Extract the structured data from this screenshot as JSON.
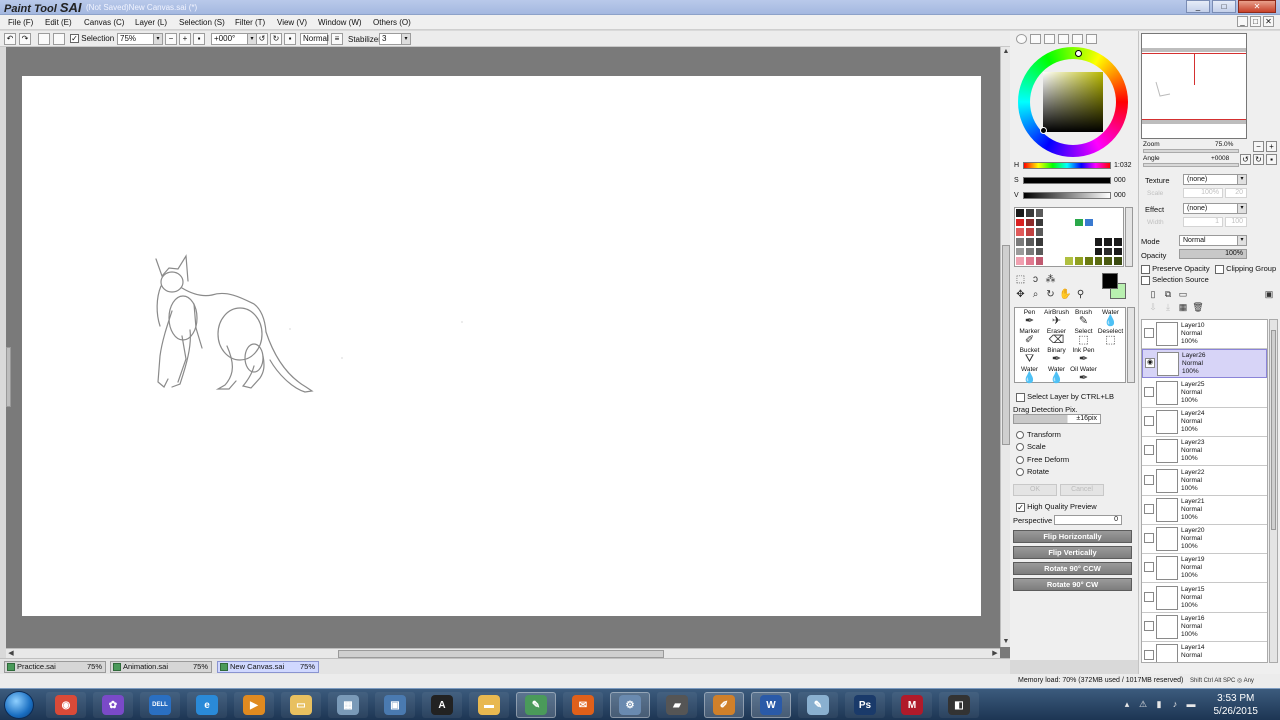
{
  "window": {
    "app_logo_small": "Paint Tool",
    "app_logo_big": "SAI",
    "title": "(Not Saved)New Canvas.sai (*)",
    "controls": {
      "minimize": "_",
      "maximize": "□",
      "close": "✕"
    }
  },
  "menu": {
    "items": [
      "File (F)",
      "Edit (E)",
      "Canvas (C)",
      "Layer (L)",
      "Selection (S)",
      "Filter (T)",
      "View (V)",
      "Window (W)",
      "Others (O)"
    ],
    "mdi": [
      "_",
      "□",
      "✕"
    ]
  },
  "toolbar": {
    "selection_label": "Selection",
    "selection_checked": "✓",
    "zoom": "75%",
    "angle": "+000°",
    "blend": "Normal",
    "stabilizer_label": "Stabilizer",
    "stabilizer_value": "3",
    "arrow": "▾"
  },
  "file_tabs": [
    {
      "name": "Practice.sai",
      "zoom": "75%"
    },
    {
      "name": "Animation.sai",
      "zoom": "75%"
    },
    {
      "name": "New Canvas.sai",
      "zoom": "75%"
    }
  ],
  "status": {
    "memory": "Memory load: 70% (372MB used / 1017MB reserved)",
    "keys": "Shift Ctrl Alt SPC ◎ Any"
  },
  "color": {
    "h_label": "H",
    "h_value": "1:032",
    "s_label": "S",
    "s_value": "000",
    "v_label": "V",
    "v_value": "000",
    "foreground": "#000000",
    "background": "#b9f0b0"
  },
  "swatches": [
    "#1a1a1a",
    "#3a3a3a",
    "#5a5a5a",
    "#ffffff",
    "#ffffff",
    "#ffffff",
    "#ffffff",
    "#ffffff",
    "#ffffff",
    "#ffffff",
    "#ffffff",
    "#d92020",
    "#8a2a2a",
    "#3a3a3a",
    "#ffffff",
    "#ffffff",
    "#ffffff",
    "#2aa84a",
    "#3a7ad0",
    "#ffffff",
    "#ffffff",
    "#ffffff",
    "#e05a5a",
    "#c04040",
    "#5a5a5a",
    "#ffffff",
    "#ffffff",
    "#ffffff",
    "#ffffff",
    "#ffffff",
    "#ffffff",
    "#ffffff",
    "#ffffff",
    "#7a7a7a",
    "#5a5a5a",
    "#3a3a3a",
    "#ffffff",
    "#ffffff",
    "#ffffff",
    "#ffffff",
    "#ffffff",
    "#1a1a1a",
    "#1a1a1a",
    "#1a1a1a",
    "#9a9a9a",
    "#7a7a7a",
    "#5a5a5a",
    "#ffffff",
    "#ffffff",
    "#ffffff",
    "#ffffff",
    "#ffffff",
    "#1a1a1a",
    "#2a2a2a",
    "#1a1a1a",
    "#f0a0b0",
    "#e07a90",
    "#c05a70",
    "#ffffff",
    "#ffffff",
    "#b0c040",
    "#90a020",
    "#6a7a10",
    "#5a6a10",
    "#4a5a10",
    "#3a4a10"
  ],
  "brushes": [
    {
      "label": "Pen"
    },
    {
      "label": "AirBrush"
    },
    {
      "label": "Brush"
    },
    {
      "label": "Water"
    },
    {
      "label": "Marker"
    },
    {
      "label": "Eraser"
    },
    {
      "label": "Select"
    },
    {
      "label": "Deselect"
    },
    {
      "label": "Bucket"
    },
    {
      "label": "Binary"
    },
    {
      "label": "Ink Pen"
    },
    {
      "label": ""
    },
    {
      "label": "Water"
    },
    {
      "label": "Water"
    },
    {
      "label": "Oil Water"
    },
    {
      "label": ""
    }
  ],
  "tool_options": {
    "select_layer_label": "Select Layer by CTRL+LB",
    "drag_detection_label": "Drag Detection Pix.",
    "drag_detection_value": "±16pix",
    "transforms": [
      "Transform",
      "Scale",
      "Free Deform",
      "Rotate"
    ],
    "ok": "OK",
    "cancel": "Cancel",
    "high_quality_label": "High Quality Preview",
    "high_quality_checked": "✓",
    "perspective_label": "Perspective",
    "perspective_value": "0",
    "buttons": [
      "Flip Horizontally",
      "Flip Vertically",
      "Rotate 90° CCW",
      "Rotate 90° CW"
    ]
  },
  "navigator": {
    "zoom_label": "Zoom",
    "zoom_value": "75.0%",
    "angle_label": "Angle",
    "angle_value": "+0008"
  },
  "layer_panel": {
    "texture_label": "Texture",
    "texture_value": "(none)",
    "texture_scale_label": "Scale",
    "texture_scale_value": "100%",
    "texture_scale_num": "20",
    "effect_label": "Effect",
    "effect_value": "(none)",
    "effect_width_label": "Width",
    "effect_width_value": "1",
    "effect_width_num": "100",
    "mode_label": "Mode",
    "mode_value": "Normal",
    "opacity_label": "Opacity",
    "opacity_value": "100%",
    "preserve_opacity": "Preserve Opacity",
    "clipping_group": "Clipping Group",
    "selection_source": "Selection Source"
  },
  "layers": [
    {
      "name": "Layer10",
      "mode": "Normal",
      "opacity": "100%"
    },
    {
      "name": "Layer26",
      "mode": "Normal",
      "opacity": "100%"
    },
    {
      "name": "Layer25",
      "mode": "Normal",
      "opacity": "100%"
    },
    {
      "name": "Layer24",
      "mode": "Normal",
      "opacity": "100%"
    },
    {
      "name": "Layer23",
      "mode": "Normal",
      "opacity": "100%"
    },
    {
      "name": "Layer22",
      "mode": "Normal",
      "opacity": "100%"
    },
    {
      "name": "Layer21",
      "mode": "Normal",
      "opacity": "100%"
    },
    {
      "name": "Layer20",
      "mode": "Normal",
      "opacity": "100%"
    },
    {
      "name": "Layer19",
      "mode": "Normal",
      "opacity": "100%"
    },
    {
      "name": "Layer15",
      "mode": "Normal",
      "opacity": "100%"
    },
    {
      "name": "Layer16",
      "mode": "Normal",
      "opacity": "100%"
    },
    {
      "name": "Layer14",
      "mode": "Normal",
      "opacity": ""
    }
  ],
  "taskbar": {
    "apps": [
      {
        "name": "chrome-icon",
        "color": "#d94a38",
        "glyph": "◉"
      },
      {
        "name": "picasa-icon",
        "color": "#7a4ac8",
        "glyph": "✿"
      },
      {
        "name": "dell-icon",
        "color": "#2a6fc2",
        "glyph": "DELL"
      },
      {
        "name": "ie-icon",
        "color": "#2a8ad8",
        "glyph": "e"
      },
      {
        "name": "media-player-icon",
        "color": "#e08a20",
        "glyph": "▶"
      },
      {
        "name": "folder-icon",
        "color": "#e8c060",
        "glyph": "▭"
      },
      {
        "name": "calculator-icon",
        "color": "#7a9ab8",
        "glyph": "▦"
      },
      {
        "name": "network-icon",
        "color": "#4a7ab0",
        "glyph": "▣"
      },
      {
        "name": "autodesk-icon",
        "color": "#222222",
        "glyph": "A"
      },
      {
        "name": "explorer-icon",
        "color": "#e8b850",
        "glyph": "▬"
      },
      {
        "name": "paint-tool-sai-icon",
        "color": "#4a9a5a",
        "glyph": "✎"
      },
      {
        "name": "mail-icon",
        "color": "#e0601a",
        "glyph": "✉"
      },
      {
        "name": "settings-icon",
        "color": "#6a8ab0",
        "glyph": "⚙"
      },
      {
        "name": "tablet-icon",
        "color": "#555555",
        "glyph": "▰"
      },
      {
        "name": "scratch-icon",
        "color": "#d0802a",
        "glyph": "✐"
      },
      {
        "name": "word-icon",
        "color": "#2a5aa8",
        "glyph": "W"
      },
      {
        "name": "paint-icon",
        "color": "#8ab0d0",
        "glyph": "✎"
      },
      {
        "name": "photoshop-icon",
        "color": "#1a3a6a",
        "glyph": "Ps"
      },
      {
        "name": "mcafee-icon",
        "color": "#b01a2a",
        "glyph": "M"
      },
      {
        "name": "app-icon",
        "color": "#333333",
        "glyph": "◧"
      }
    ],
    "time": "3:53 PM",
    "date": "5/26/2015"
  }
}
